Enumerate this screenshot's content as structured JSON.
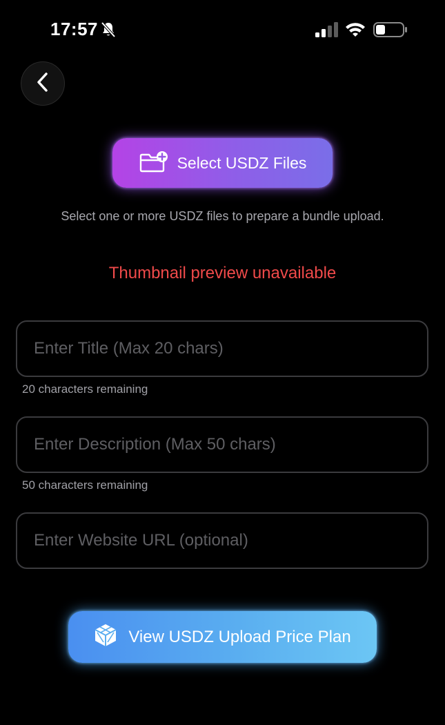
{
  "status_bar": {
    "time": "17:57",
    "icons": [
      "bell-slash-icon",
      "cellular-signal-icon",
      "wifi-icon",
      "battery-icon"
    ]
  },
  "nav": {
    "back_icon": "chevron-left-icon"
  },
  "select_files": {
    "label": "Select USDZ Files",
    "icon": "folder-add-icon",
    "gradient": [
      "#b443e6",
      "#7a6ee8"
    ]
  },
  "hint": "Select one or more USDZ files to prepare a bundle upload.",
  "thumbnail_error": "Thumbnail preview unavailable",
  "form": {
    "title": {
      "value": "",
      "placeholder": "Enter Title (Max 20 chars)",
      "remaining": "20 characters remaining"
    },
    "description": {
      "value": "",
      "placeholder": "Enter Description (Max 50 chars)",
      "remaining": "50 characters remaining"
    },
    "website": {
      "value": "",
      "placeholder": "Enter Website URL (optional)"
    }
  },
  "price_plan": {
    "label": "View USDZ Upload Price Plan",
    "icon": "cube-icon",
    "gradient": [
      "#4a8ff0",
      "#6cc6f4"
    ]
  },
  "colors": {
    "background": "#000000",
    "error": "#f04a4a",
    "muted_text": "#a8a8ae",
    "field_border": "#3b3b3e"
  }
}
